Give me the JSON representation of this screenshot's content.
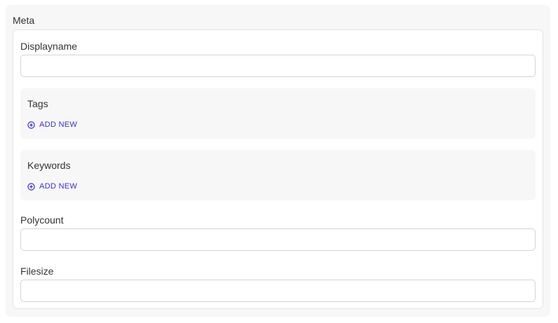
{
  "section": {
    "title": "Meta"
  },
  "fields": {
    "displayname": {
      "label": "Displayname",
      "value": "",
      "placeholder": ""
    },
    "tags": {
      "label": "Tags",
      "add_label": "ADD NEW"
    },
    "keywords": {
      "label": "Keywords",
      "add_label": "ADD NEW"
    },
    "polycount": {
      "label": "Polycount",
      "value": "",
      "placeholder": ""
    },
    "filesize": {
      "label": "Filesize",
      "value": "",
      "placeholder": ""
    }
  },
  "icons": {
    "add": "plus-circle-icon"
  },
  "colors": {
    "accent": "#3730d6",
    "panel_bg": "#f7f7f8",
    "border": "#e4e4e7"
  }
}
